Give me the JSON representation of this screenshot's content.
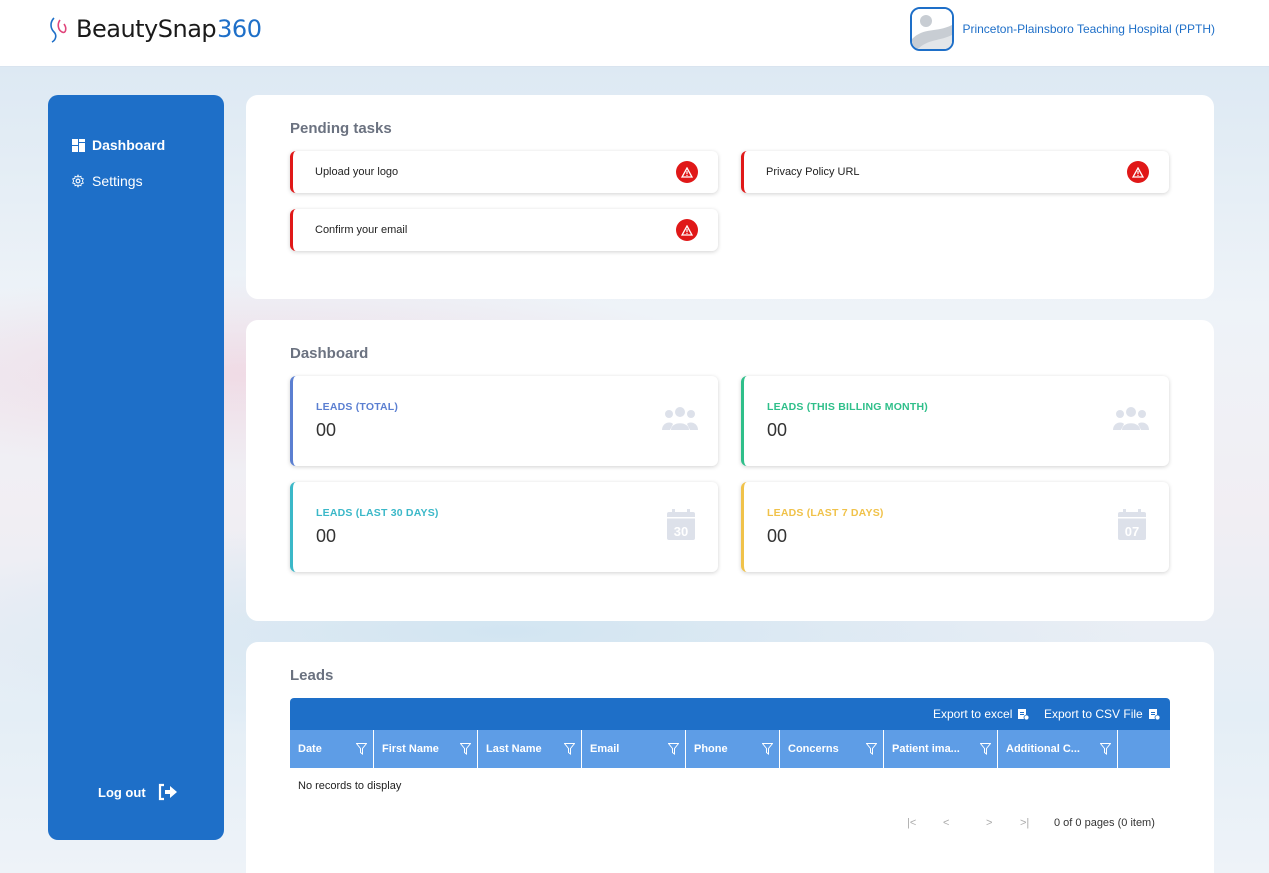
{
  "app": {
    "logo_name": "BeautySnap",
    "logo_num": "360"
  },
  "org": {
    "name": "Princeton-Plainsboro Teaching Hospital (PPTH)"
  },
  "sidebar": {
    "items": [
      {
        "label": "Dashboard",
        "icon": "dashboard-grid-icon",
        "active": true
      },
      {
        "label": "Settings",
        "icon": "gear-icon",
        "active": false
      }
    ],
    "logout_label": "Log out",
    "logout_icon": "logout-arrow-icon"
  },
  "pending": {
    "title": "Pending tasks",
    "tasks": [
      {
        "label": "Upload your logo",
        "icon": "warning-triangle-icon"
      },
      {
        "label": "Privacy Policy URL",
        "icon": "warning-triangle-icon"
      },
      {
        "label": "Confirm your email",
        "icon": "warning-triangle-icon"
      }
    ]
  },
  "dashboard": {
    "title": "Dashboard",
    "stats": [
      {
        "label": "LEADS (TOTAL)",
        "value": "00",
        "color": "#5b7fd1",
        "icon": "users-group-icon"
      },
      {
        "label": "LEADS (THIS BILLING MONTH)",
        "value": "00",
        "color": "#2fbf8a",
        "icon": "users-group-icon"
      },
      {
        "label": "LEADS (LAST 30 DAYS)",
        "value": "00",
        "color": "#3bb8c8",
        "icon": "calendar-30-icon",
        "icon_text": "30"
      },
      {
        "label": "LEADS (LAST 7 DAYS)",
        "value": "00",
        "color": "#f0c24a",
        "icon": "calendar-07-icon",
        "icon_text": "07"
      }
    ]
  },
  "leads": {
    "title": "Leads",
    "export_excel": "Export to excel",
    "export_csv": "Export to CSV File",
    "columns": [
      "Date",
      "First Name",
      "Last Name",
      "Email",
      "Phone",
      "Concerns",
      "Patient ima...",
      "Additional C..."
    ],
    "empty_text": "No records to display",
    "pager_info": "0 of 0 pages (0 item)",
    "pager_first": "|<",
    "pager_prev": "<",
    "pager_next": ">",
    "pager_last": ">|"
  },
  "colors": {
    "primary": "#1e6fc8",
    "header_cols": "#5e9de6",
    "alert": "#e01818"
  }
}
